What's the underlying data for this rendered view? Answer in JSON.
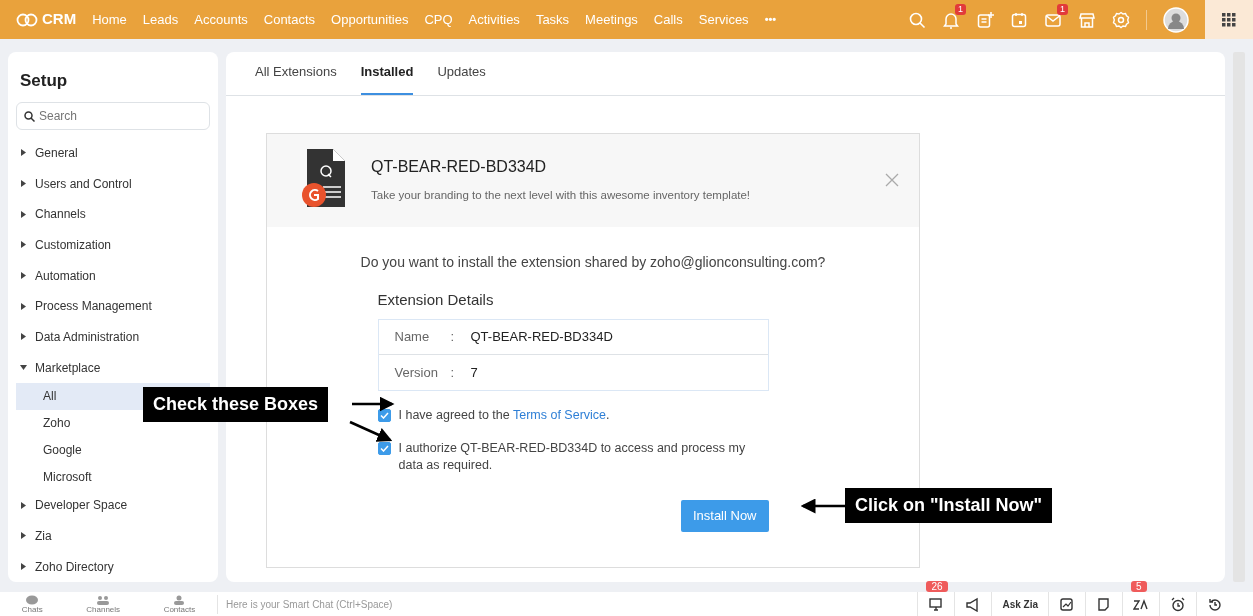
{
  "topbar": {
    "logo": "CRM",
    "nav": [
      "Home",
      "Leads",
      "Accounts",
      "Contacts",
      "Opportunities",
      "CPQ",
      "Activities",
      "Tasks",
      "Meetings",
      "Calls",
      "Services"
    ],
    "more": "•••",
    "icons": [
      {
        "kind": "search"
      },
      {
        "kind": "bell",
        "badge": "1"
      },
      {
        "kind": "note-plus"
      },
      {
        "kind": "calendar"
      },
      {
        "kind": "mail",
        "badge": "1"
      },
      {
        "kind": "store"
      },
      {
        "kind": "gear"
      }
    ]
  },
  "sidebar": {
    "title": "Setup",
    "search": {
      "placeholder": "Search"
    },
    "items": [
      {
        "label": "General",
        "expanded": false
      },
      {
        "label": "Users and Control",
        "expanded": false
      },
      {
        "label": "Channels",
        "expanded": false
      },
      {
        "label": "Customization",
        "expanded": false
      },
      {
        "label": "Automation",
        "expanded": false
      },
      {
        "label": "Process Management",
        "expanded": false
      },
      {
        "label": "Data Administration",
        "expanded": false
      },
      {
        "label": "Marketplace",
        "expanded": true,
        "children": [
          {
            "label": "All",
            "selected": true
          },
          {
            "label": "Zoho",
            "selected": false
          },
          {
            "label": "Google",
            "selected": false
          },
          {
            "label": "Microsoft",
            "selected": false
          }
        ]
      },
      {
        "label": "Developer Space",
        "expanded": false
      },
      {
        "label": "Zia",
        "expanded": false
      },
      {
        "label": "Zoho Directory",
        "expanded": false
      }
    ]
  },
  "tabs": [
    {
      "label": "All Extensions",
      "selected": false
    },
    {
      "label": "Installed",
      "selected": true
    },
    {
      "label": "Updates",
      "selected": false
    }
  ],
  "extension": {
    "title": "QT-BEAR-RED-BD334D",
    "description": "Take your branding to the next level with this awesome inventory template!",
    "question": "Do you want to install the extension shared by zoho@glionconsulting.com?",
    "details_title": "Extension Details",
    "details": [
      {
        "label": "Name",
        "separator": ":",
        "value": "QT-BEAR-RED-BD334D"
      },
      {
        "label": "Version",
        "separator": ":",
        "value": "7"
      }
    ],
    "consents": [
      {
        "text": "I have agreed to the ",
        "link": "Terms of Service",
        "suffix": ".",
        "checked": true
      },
      {
        "text": "I authorize QT-BEAR-RED-BD334D to access and process my data as required.",
        "checked": true
      }
    ],
    "install_button": "Install Now"
  },
  "annotations": [
    {
      "text": "Check these Boxes"
    },
    {
      "text": "Click on \"Install Now\""
    }
  ],
  "bottombar": {
    "tabs": [
      "Chats",
      "Channels",
      "Contacts"
    ],
    "chat_placeholder": "Here is your Smart Chat (Ctrl+Space)",
    "tools": [
      {
        "kind": "screen",
        "badge": "26"
      },
      {
        "kind": "megaphone"
      },
      {
        "kind": "text",
        "label": "Ask Zia"
      },
      {
        "kind": "chart"
      },
      {
        "kind": "note"
      },
      {
        "kind": "zia",
        "badge": "5"
      },
      {
        "kind": "alarm"
      },
      {
        "kind": "history"
      }
    ]
  }
}
